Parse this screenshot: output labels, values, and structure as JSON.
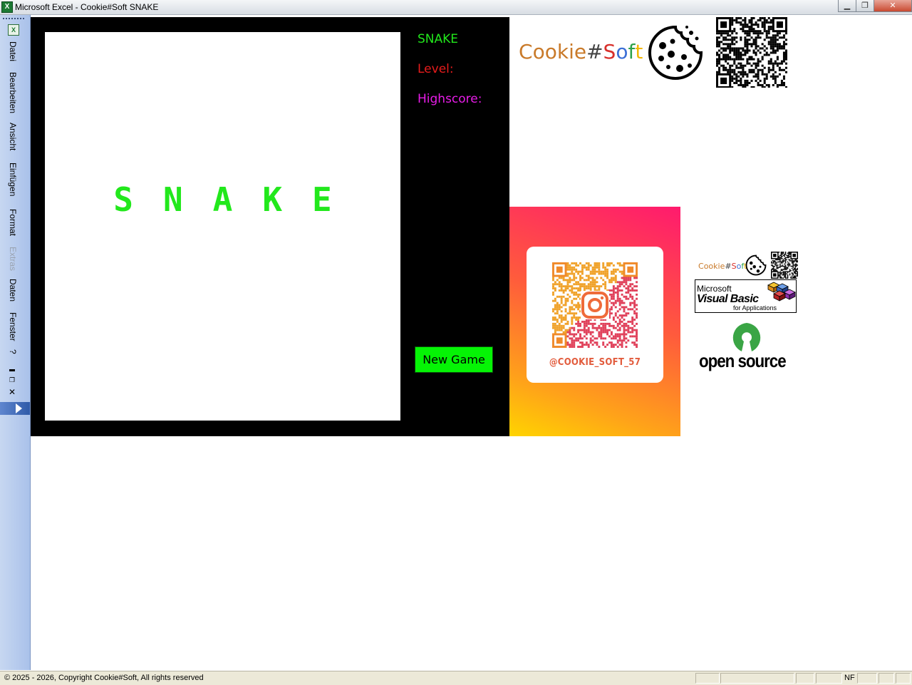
{
  "window": {
    "title": "Microsoft Excel - Cookie#Soft SNAKE",
    "app_icon": "excel-icon",
    "controls": [
      "minimize-icon",
      "restore-icon",
      "close-icon"
    ]
  },
  "menu": {
    "items": [
      {
        "label": "Datei",
        "enabled": true
      },
      {
        "label": "Bearbeiten",
        "enabled": true
      },
      {
        "label": "Ansicht",
        "enabled": true
      },
      {
        "label": "Einfügen",
        "enabled": true
      },
      {
        "label": "Format",
        "enabled": true
      },
      {
        "label": "Extras",
        "enabled": false
      },
      {
        "label": "Daten",
        "enabled": true
      },
      {
        "label": "Fenster",
        "enabled": true
      },
      {
        "label": "?",
        "enabled": true
      }
    ]
  },
  "game": {
    "title_text": "SNAKE",
    "info": {
      "name": "SNAKE",
      "level_label": "Level:",
      "highscore_label": "Highscore:"
    },
    "new_game_label": "New Game",
    "colors": {
      "title": "#22e81c",
      "name": "#22e81c",
      "level": "#e81c1c",
      "highscore": "#e81ce8",
      "button": "#05f405"
    }
  },
  "branding": {
    "cookie_soft_letters": [
      {
        "ch": "C",
        "color": "#c97a2a"
      },
      {
        "ch": "o",
        "color": "#c97a2a"
      },
      {
        "ch": "o",
        "color": "#c97a2a"
      },
      {
        "ch": "k",
        "color": "#c97a2a"
      },
      {
        "ch": "i",
        "color": "#c97a2a"
      },
      {
        "ch": "e",
        "color": "#c97a2a"
      },
      {
        "ch": "#",
        "color": "#444444"
      },
      {
        "ch": "S",
        "color": "#d8302b"
      },
      {
        "ch": "o",
        "color": "#3b6fd6"
      },
      {
        "ch": "f",
        "color": "#2da14a"
      },
      {
        "ch": "t",
        "color": "#f2b705"
      }
    ],
    "instagram_handle": "@COOKIE_SOFT_57",
    "vba": {
      "vendor": "Microsoft",
      "product": "Visual Basic",
      "tagline": "for Applications"
    },
    "open_source": "open source"
  },
  "statusbar": {
    "text": "© 2025 - 2026, Copyright Cookie#Soft, All rights reserved",
    "nf": "NF"
  }
}
